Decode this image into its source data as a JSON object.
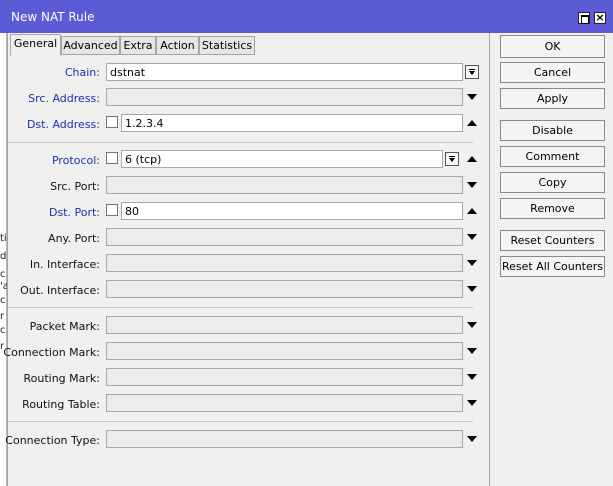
{
  "window": {
    "title": "New NAT Rule"
  },
  "background_fragments": [
    "ti",
    "d",
    "c",
    "'a",
    "c",
    "r",
    "c",
    "r"
  ],
  "tabs": [
    {
      "label": "General",
      "active": true
    },
    {
      "label": "Advanced",
      "active": false
    },
    {
      "label": "Extra",
      "active": false
    },
    {
      "label": "Action",
      "active": false
    },
    {
      "label": "Statistics",
      "active": false
    }
  ],
  "form": {
    "chain": {
      "label": "Chain:",
      "value": "dstnat"
    },
    "src_address": {
      "label": "Src. Address:",
      "value": ""
    },
    "dst_address": {
      "label": "Dst. Address:",
      "value": "1.2.3.4"
    },
    "protocol": {
      "label": "Protocol:",
      "value": "6 (tcp)"
    },
    "src_port": {
      "label": "Src. Port:",
      "value": ""
    },
    "dst_port": {
      "label": "Dst. Port:",
      "value": "80"
    },
    "any_port": {
      "label": "Any. Port:",
      "value": ""
    },
    "in_interface": {
      "label": "In. Interface:",
      "value": ""
    },
    "out_interface": {
      "label": "Out. Interface:",
      "value": ""
    },
    "packet_mark": {
      "label": "Packet Mark:",
      "value": ""
    },
    "connection_mark": {
      "label": "Connection Mark:",
      "value": ""
    },
    "routing_mark": {
      "label": "Routing Mark:",
      "value": ""
    },
    "routing_table": {
      "label": "Routing Table:",
      "value": ""
    },
    "connection_type": {
      "label": "Connection Type:",
      "value": ""
    }
  },
  "buttons": {
    "ok": "OK",
    "cancel": "Cancel",
    "apply": "Apply",
    "disable": "Disable",
    "comment": "Comment",
    "copy": "Copy",
    "remove": "Remove",
    "reset_counters": "Reset Counters",
    "reset_all_counters": "Reset All Counters"
  },
  "colors": {
    "titlebar": "#5b5bd6",
    "label_blue": "#1a32a8",
    "panel_bg": "#f0f0f0"
  }
}
